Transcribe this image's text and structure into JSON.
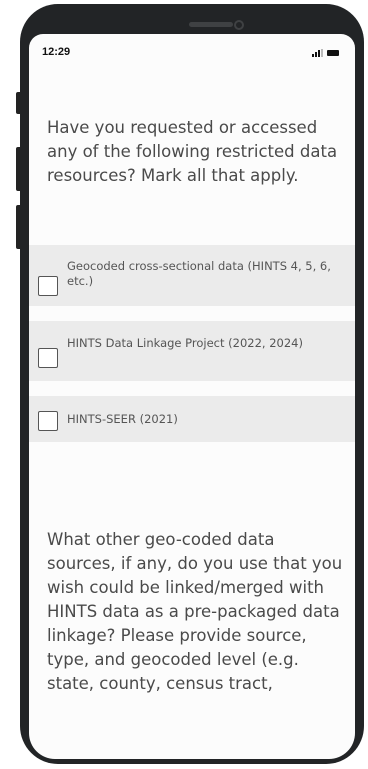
{
  "status_bar": {
    "time": "12:29",
    "icons": [
      "signal-icon",
      "battery-icon"
    ]
  },
  "survey": {
    "question1": {
      "text": "Have you requested or accessed any of the following restricted data resources? Mark all that apply.",
      "options": [
        {
          "label": "Geocoded cross-sectional data (HINTS 4, 5, 6, etc.)",
          "checked": false
        },
        {
          "label": "HINTS Data Linkage Project (2022, 2024)",
          "checked": false
        },
        {
          "label": "HINTS-SEER (2021)",
          "checked": false
        }
      ]
    },
    "question2": {
      "text": "What other geo-coded data sources, if any, do you use that you wish could be linked/merged with HINTS data as a pre-packaged data linkage? Please provide source, type, and geocoded level (e.g. state, county, census tract,"
    }
  },
  "colors": {
    "phone_body": "#222426",
    "screen_bg": "#fcfcfc",
    "option_bg": "#ebebeb",
    "question_text": "#4a4a4a"
  }
}
